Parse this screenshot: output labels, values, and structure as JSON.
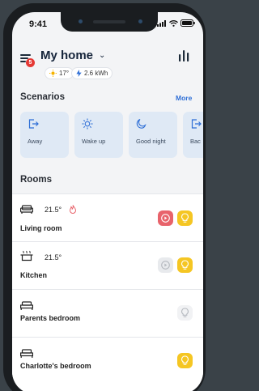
{
  "status_bar": {
    "time": "9:41"
  },
  "header": {
    "title": "My home",
    "notification_count": "5",
    "weather_temp": "17°",
    "energy": "2.6 kWh"
  },
  "scenarios": {
    "title": "Scenarios",
    "more_label": "More",
    "items": [
      {
        "label": "Away",
        "icon": "door-exit-icon"
      },
      {
        "label": "Wake up",
        "icon": "sun-icon"
      },
      {
        "label": "Good night",
        "icon": "moon-icon"
      },
      {
        "label": "Bac",
        "icon": "door-exit-icon"
      }
    ]
  },
  "rooms": {
    "title": "Rooms",
    "items": [
      {
        "name": "Living room",
        "temperature": "21.5°",
        "heating": true,
        "icon": "sofa-icon",
        "devices": [
          {
            "type": "media",
            "active": true
          },
          {
            "type": "light",
            "active": true
          }
        ]
      },
      {
        "name": "Kitchen",
        "temperature": "21.5°",
        "heating": false,
        "icon": "cooking-pot-icon",
        "devices": [
          {
            "type": "media",
            "active": false
          },
          {
            "type": "light",
            "active": true
          }
        ]
      },
      {
        "name": "Parents bedroom",
        "icon": "bed-icon",
        "devices": [
          {
            "type": "light",
            "active": false
          }
        ]
      },
      {
        "name": "Charlotte's bedroom",
        "icon": "bed-icon",
        "devices": [
          {
            "type": "light",
            "active": true
          }
        ]
      }
    ]
  },
  "colors": {
    "accent_blue": "#2f6fd6",
    "scenario_bg": "#dfe9f5",
    "media_active": "#e8636b",
    "light_active": "#f5c623",
    "badge_red": "#e53935"
  }
}
